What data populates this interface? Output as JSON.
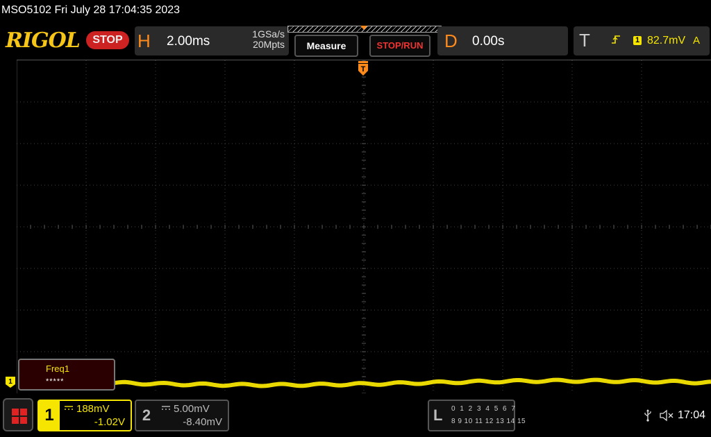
{
  "titlebar": {
    "text": "MSO5102  Fri July 28 17:04:35 2023"
  },
  "header": {
    "logo": "RIGOL",
    "status": "STOP",
    "horizontal": {
      "letter": "H",
      "timebase": "2.00ms",
      "sample_rate": "1GSa/s",
      "memory_depth": "20Mpts"
    },
    "measure_label": "Measure",
    "stoprun_label": "STOP/RUN",
    "delay": {
      "letter": "D",
      "value": "0.00s"
    },
    "trigger": {
      "letter": "T",
      "edge_icon": "rising-edge-icon",
      "source": "1",
      "level": "82.7mV",
      "mode": "A"
    }
  },
  "screen": {
    "trigger_marker": "T",
    "channel_marker": "1",
    "measurement": {
      "label": "Freq1",
      "value": "*****"
    }
  },
  "footer": {
    "ch1": {
      "number": "1",
      "coupling": "DC",
      "scale": "188mV",
      "offset": "-1.02V"
    },
    "ch2": {
      "number": "2",
      "coupling": "DC",
      "scale": "5.00mV",
      "offset": "-8.40mV"
    },
    "logic": {
      "letter": "L",
      "row1": "0 1 2 3  4 5 6 7",
      "row2": "8 9 10 11 12 13 14 15"
    },
    "usb_icon": "usb-icon",
    "speaker_icon": "speaker-muted-icon",
    "time": "17:04"
  },
  "colors": {
    "ch1": "#f5e500",
    "accent": "#ff8a1c",
    "stop": "#cc2222"
  }
}
